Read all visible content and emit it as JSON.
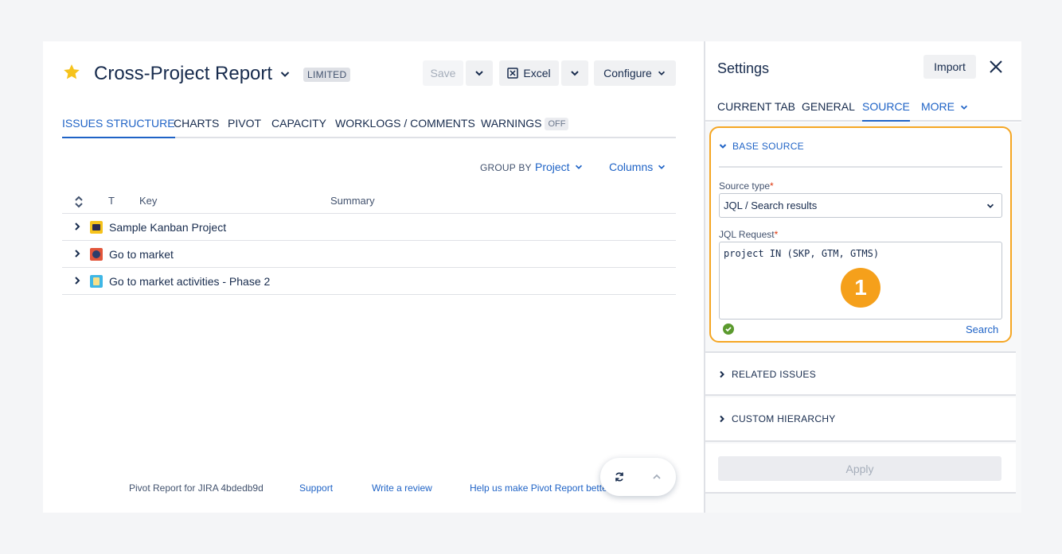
{
  "report": {
    "title": "Cross-Project Report",
    "badge": "LIMITED"
  },
  "toolbar": {
    "save_label": "Save",
    "excel_label": "Excel",
    "configure_label": "Configure"
  },
  "tabs": [
    {
      "label": "ISSUES STRUCTURE",
      "active": true
    },
    {
      "label": "CHARTS"
    },
    {
      "label": "PIVOT"
    },
    {
      "label": "CAPACITY"
    },
    {
      "label": "WORKLOGS / COMMENTS"
    },
    {
      "label": "WARNINGS",
      "badge": "OFF"
    }
  ],
  "group_by": {
    "label": "GROUP BY",
    "value": "Project",
    "columns_label": "Columns"
  },
  "table": {
    "headers": {
      "type": "T",
      "key": "Key",
      "summary": "Summary"
    },
    "rows": [
      {
        "label": "Sample Kanban Project",
        "icon": "kanban-project-icon",
        "color": "#f6c31c"
      },
      {
        "label": "Go to market",
        "icon": "market-project-icon",
        "color": "#e2553a"
      },
      {
        "label": "Go to market activities - Phase 2",
        "icon": "activities-project-icon",
        "color": "#3fb7e6"
      }
    ]
  },
  "footer": {
    "version": "Pivot Report for JIRA 4bdedb9d",
    "support": "Support",
    "review": "Write a review",
    "help": "Help us make Pivot Report better"
  },
  "settings": {
    "title": "Settings",
    "import_label": "Import",
    "tabs": [
      {
        "label": "CURRENT TAB"
      },
      {
        "label": "GENERAL"
      },
      {
        "label": "SOURCE",
        "active": true
      },
      {
        "label": "MORE"
      }
    ],
    "base_source": {
      "heading": "BASE SOURCE",
      "source_type_label": "Source type",
      "source_type_value": "JQL / Search results",
      "jql_label": "JQL Request",
      "jql_value": "project IN (SKP, GTM, GTMS)",
      "search_label": "Search",
      "callout_number": "1"
    },
    "related_issues": "RELATED ISSUES",
    "custom_hierarchy": "CUSTOM HIERARCHY",
    "apply_label": "Apply"
  },
  "colors": {
    "accent": "#1f63c6",
    "highlight": "#f5a623",
    "star": "#f6c31c",
    "ok": "#5b9a2e"
  }
}
